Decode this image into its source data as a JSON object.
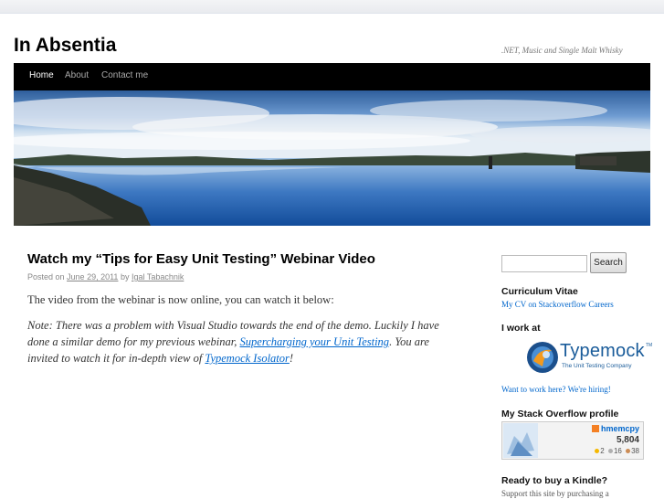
{
  "site": {
    "title": "In Absentia",
    "tagline": ".NET, Music and Single Malt Whisky"
  },
  "nav": {
    "items": [
      {
        "label": "Home",
        "active": true
      },
      {
        "label": "About",
        "active": false
      },
      {
        "label": "Contact me",
        "active": false
      }
    ]
  },
  "post": {
    "title": "Watch my “Tips for Easy Unit Testing” Webinar Video",
    "posted_on": "Posted on",
    "date": "June 29, 2011",
    "by": "by",
    "author": "Igal Tabachnik",
    "para1": "The video from the webinar is now online, you can watch it below:",
    "note_prefix": "Note: There was a problem with Visual Studio towards the end of the demo. Luckily I have done a similar demo for my previous webinar, ",
    "note_link1": "Supercharging your Unit Testing",
    "note_mid": ". You are invited to watch it for in-depth view of ",
    "note_link2": "Typemock Isolator",
    "note_end": "!"
  },
  "sidebar": {
    "search_button": "Search",
    "search_value": "",
    "cv_title": "Curriculum Vitae",
    "cv_link": "My CV on Stackoverflow Careers",
    "work_title": "I work at",
    "typemock_name": "Typemock",
    "typemock_tm": "TM",
    "typemock_tagline": "The Unit Testing Company",
    "hiring_link": "Want to work here? We're hiring!",
    "so_title": "My Stack Overflow profile",
    "so_user": "hmemcpy",
    "so_rep": "5,804",
    "so_gold": "2",
    "so_silver": "16",
    "so_bronze": "38",
    "kindle_title": "Ready to buy a Kindle?",
    "kindle_text": "Support this site by purchasing a"
  },
  "colors": {
    "link": "#0066cc",
    "nav_bg": "#000000",
    "gold": "#f5b800",
    "silver": "#b0b0b0",
    "bronze": "#cc8c55"
  }
}
